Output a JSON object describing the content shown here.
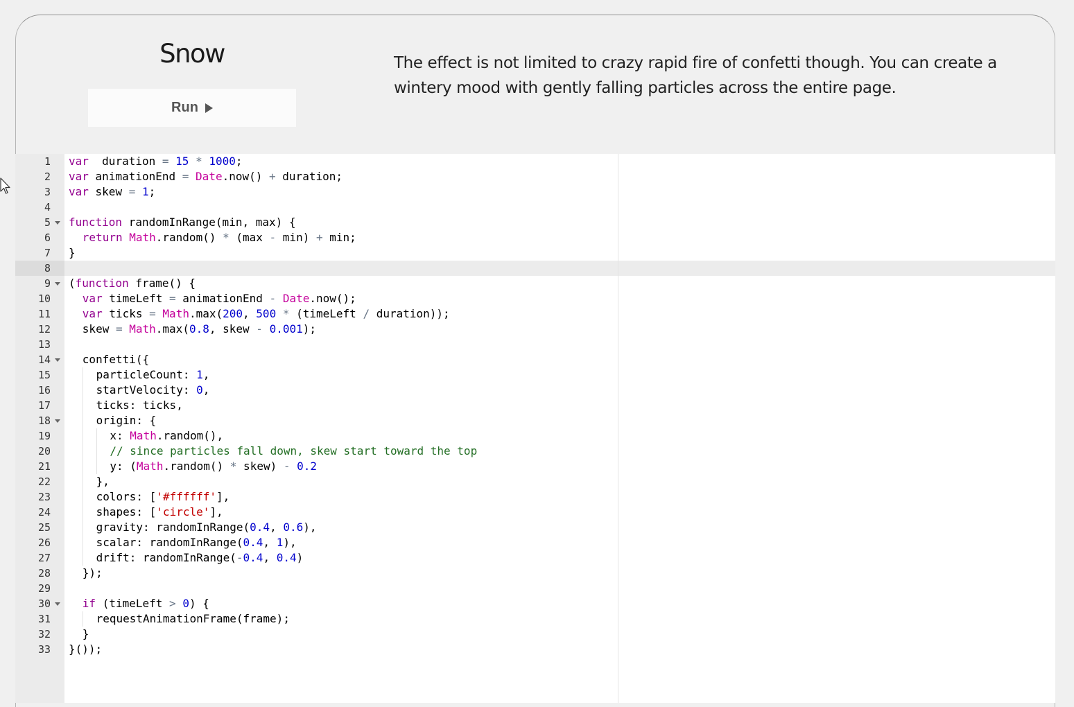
{
  "section": {
    "title": "Snow",
    "run_label": "Run",
    "description": "The effect is not limited to crazy rapid fire of confetti though. You can create a wintery mood with gently falling particles across the entire page."
  },
  "editor": {
    "active_line": 8,
    "fold_lines": [
      5,
      9,
      14,
      18,
      30
    ],
    "lines": [
      {
        "n": "1",
        "indent": 0,
        "tokens": [
          [
            "kw",
            "var"
          ],
          [
            "",
            "  duration "
          ],
          [
            "op",
            "="
          ],
          [
            "",
            " "
          ],
          [
            "num",
            "15"
          ],
          [
            "",
            " "
          ],
          [
            "op",
            "*"
          ],
          [
            "",
            " "
          ],
          [
            "num",
            "1000"
          ],
          [
            "",
            ";"
          ]
        ]
      },
      {
        "n": "2",
        "indent": 0,
        "tokens": [
          [
            "kw",
            "var"
          ],
          [
            "",
            " animationEnd "
          ],
          [
            "op",
            "="
          ],
          [
            "",
            " "
          ],
          [
            "sup",
            "Date"
          ],
          [
            "",
            ".now() "
          ],
          [
            "op",
            "+"
          ],
          [
            "",
            " duration;"
          ]
        ]
      },
      {
        "n": "3",
        "indent": 0,
        "tokens": [
          [
            "kw",
            "var"
          ],
          [
            "",
            " skew "
          ],
          [
            "op",
            "="
          ],
          [
            "",
            " "
          ],
          [
            "num",
            "1"
          ],
          [
            "",
            ";"
          ]
        ]
      },
      {
        "n": "4",
        "indent": 0,
        "tokens": []
      },
      {
        "n": "5",
        "indent": 0,
        "tokens": [
          [
            "kw",
            "function"
          ],
          [
            "",
            " randomInRange(min, max) {"
          ]
        ]
      },
      {
        "n": "6",
        "indent": 1,
        "tokens": [
          [
            "kw",
            "return"
          ],
          [
            "",
            " "
          ],
          [
            "sup",
            "Math"
          ],
          [
            "",
            ".random() "
          ],
          [
            "op",
            "*"
          ],
          [
            "",
            " (max "
          ],
          [
            "op",
            "-"
          ],
          [
            "",
            " min) "
          ],
          [
            "op",
            "+"
          ],
          [
            "",
            " min;"
          ]
        ]
      },
      {
        "n": "7",
        "indent": 0,
        "tokens": [
          [
            "",
            "}"
          ]
        ]
      },
      {
        "n": "8",
        "indent": 0,
        "tokens": []
      },
      {
        "n": "9",
        "indent": 0,
        "tokens": [
          [
            "",
            "("
          ],
          [
            "kw",
            "function"
          ],
          [
            "",
            " frame() {"
          ]
        ]
      },
      {
        "n": "10",
        "indent": 1,
        "tokens": [
          [
            "kw",
            "var"
          ],
          [
            "",
            " timeLeft "
          ],
          [
            "op",
            "="
          ],
          [
            "",
            " animationEnd "
          ],
          [
            "op",
            "-"
          ],
          [
            "",
            " "
          ],
          [
            "sup",
            "Date"
          ],
          [
            "",
            ".now();"
          ]
        ]
      },
      {
        "n": "11",
        "indent": 1,
        "tokens": [
          [
            "kw",
            "var"
          ],
          [
            "",
            " ticks "
          ],
          [
            "op",
            "="
          ],
          [
            "",
            " "
          ],
          [
            "sup",
            "Math"
          ],
          [
            "",
            ".max("
          ],
          [
            "num",
            "200"
          ],
          [
            "",
            ", "
          ],
          [
            "num",
            "500"
          ],
          [
            "",
            " "
          ],
          [
            "op",
            "*"
          ],
          [
            "",
            " (timeLeft "
          ],
          [
            "op",
            "/"
          ],
          [
            "",
            " duration));"
          ]
        ]
      },
      {
        "n": "12",
        "indent": 1,
        "tokens": [
          [
            "",
            "skew "
          ],
          [
            "op",
            "="
          ],
          [
            "",
            " "
          ],
          [
            "sup",
            "Math"
          ],
          [
            "",
            ".max("
          ],
          [
            "num",
            "0.8"
          ],
          [
            "",
            ", skew "
          ],
          [
            "op",
            "-"
          ],
          [
            "",
            " "
          ],
          [
            "num",
            "0.001"
          ],
          [
            "",
            ");"
          ]
        ]
      },
      {
        "n": "13",
        "indent": 0,
        "tokens": []
      },
      {
        "n": "14",
        "indent": 1,
        "tokens": [
          [
            "",
            "confetti({"
          ]
        ]
      },
      {
        "n": "15",
        "indent": 2,
        "tokens": [
          [
            "",
            "particleCount: "
          ],
          [
            "num",
            "1"
          ],
          [
            "",
            ","
          ]
        ]
      },
      {
        "n": "16",
        "indent": 2,
        "tokens": [
          [
            "",
            "startVelocity: "
          ],
          [
            "num",
            "0"
          ],
          [
            "",
            ","
          ]
        ]
      },
      {
        "n": "17",
        "indent": 2,
        "tokens": [
          [
            "",
            "ticks: ticks,"
          ]
        ]
      },
      {
        "n": "18",
        "indent": 2,
        "tokens": [
          [
            "",
            "origin: {"
          ]
        ]
      },
      {
        "n": "19",
        "indent": 3,
        "tokens": [
          [
            "",
            "x: "
          ],
          [
            "sup",
            "Math"
          ],
          [
            "",
            ".random(),"
          ]
        ]
      },
      {
        "n": "20",
        "indent": 3,
        "tokens": [
          [
            "cm",
            "// since particles fall down, skew start toward the top"
          ]
        ]
      },
      {
        "n": "21",
        "indent": 3,
        "tokens": [
          [
            "",
            "y: ("
          ],
          [
            "sup",
            "Math"
          ],
          [
            "",
            ".random() "
          ],
          [
            "op",
            "*"
          ],
          [
            "",
            " skew) "
          ],
          [
            "op",
            "-"
          ],
          [
            "",
            " "
          ],
          [
            "num",
            "0.2"
          ]
        ]
      },
      {
        "n": "22",
        "indent": 2,
        "tokens": [
          [
            "",
            "},"
          ]
        ]
      },
      {
        "n": "23",
        "indent": 2,
        "tokens": [
          [
            "",
            "colors: ["
          ],
          [
            "str",
            "'#ffffff'"
          ],
          [
            "",
            "],"
          ]
        ]
      },
      {
        "n": "24",
        "indent": 2,
        "tokens": [
          [
            "",
            "shapes: ["
          ],
          [
            "str",
            "'circle'"
          ],
          [
            "",
            "],"
          ]
        ]
      },
      {
        "n": "25",
        "indent": 2,
        "tokens": [
          [
            "",
            "gravity: randomInRange("
          ],
          [
            "num",
            "0.4"
          ],
          [
            "",
            ", "
          ],
          [
            "num",
            "0.6"
          ],
          [
            "",
            "),"
          ]
        ]
      },
      {
        "n": "26",
        "indent": 2,
        "tokens": [
          [
            "",
            "scalar: randomInRange("
          ],
          [
            "num",
            "0.4"
          ],
          [
            "",
            ", "
          ],
          [
            "num",
            "1"
          ],
          [
            "",
            "),"
          ]
        ]
      },
      {
        "n": "27",
        "indent": 2,
        "tokens": [
          [
            "",
            "drift: randomInRange("
          ],
          [
            "op",
            "-"
          ],
          [
            "num",
            "0.4"
          ],
          [
            "",
            ", "
          ],
          [
            "num",
            "0.4"
          ],
          [
            "",
            ")"
          ]
        ]
      },
      {
        "n": "28",
        "indent": 1,
        "tokens": [
          [
            "",
            "});"
          ]
        ]
      },
      {
        "n": "29",
        "indent": 0,
        "tokens": []
      },
      {
        "n": "30",
        "indent": 1,
        "tokens": [
          [
            "kw",
            "if"
          ],
          [
            "",
            " (timeLeft "
          ],
          [
            "op",
            ">"
          ],
          [
            "",
            " "
          ],
          [
            "num",
            "0"
          ],
          [
            "",
            ") {"
          ]
        ]
      },
      {
        "n": "31",
        "indent": 2,
        "tokens": [
          [
            "",
            "requestAnimationFrame(frame);"
          ]
        ]
      },
      {
        "n": "32",
        "indent": 1,
        "tokens": [
          [
            "",
            "}"
          ]
        ]
      },
      {
        "n": "33",
        "indent": 0,
        "tokens": [
          [
            "",
            "}());"
          ]
        ]
      }
    ]
  }
}
